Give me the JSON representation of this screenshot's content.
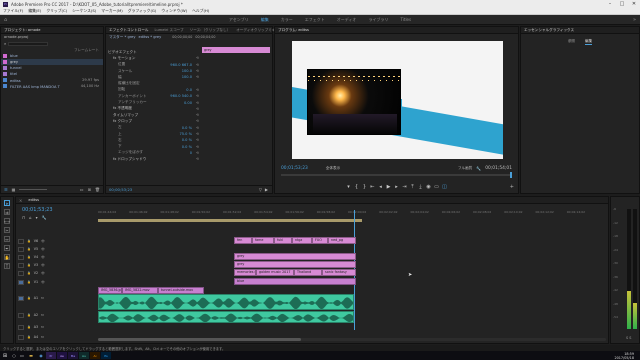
{
  "window": {
    "title": "Adobe Premiere Pro CC 2017 - D:\\KDOT_05_Adobe_tutorial\\tpremiere\\timeline.prproj *"
  },
  "menu": [
    "ファイル(F)",
    "編集(E)",
    "クリップ(C)",
    "シーケンス(S)",
    "マーカー(M)",
    "グラフィック(G)",
    "ウィンドウ(W)",
    "ヘルプ(H)"
  ],
  "workspaces": [
    {
      "label": "アセンブリ",
      "active": false
    },
    {
      "label": "編集",
      "active": true
    },
    {
      "label": "カラー",
      "active": false
    },
    {
      "label": "エフェクト",
      "active": false
    },
    {
      "label": "オーディオ",
      "active": false
    },
    {
      "label": "ライブラリ",
      "active": false
    },
    {
      "label": "Titles",
      "active": false
    }
  ],
  "project": {
    "tab": "プロジェクト: ornode",
    "filename": "ornode.prproj",
    "search_placeholder": "検索",
    "items_label": "フレームレート",
    "items": [
      {
        "label": "blue",
        "color": "#d06ad0",
        "fps": ""
      },
      {
        "label": "grey",
        "color": "#d06ad0",
        "fps": ""
      },
      {
        "label": "tunnel",
        "color": "#a77ad2",
        "fps": ""
      },
      {
        "label": "titel",
        "color": "#a77ad2",
        "fps": ""
      },
      {
        "label": "editss",
        "color": "#4c86cf",
        "fps": "29.97 fps"
      },
      {
        "label": "FILTER AAS kmp MANDOA T",
        "color": "#4c86cf",
        "fps": "44,100 Hz"
      }
    ]
  },
  "effects": {
    "tabs": [
      "エフェクトコントロール",
      "Lumetri スコープ",
      "ソース:（クリップなし）",
      "オーディオクリップミキサー"
    ],
    "source": "マスター * grey",
    "sequence": "editss * grey",
    "tc_start": "00;00;00;00",
    "tc_end": "00;00;04;00",
    "clip_label": "grey",
    "sections": [
      {
        "label": "ビデオエフェクト",
        "indent": 0
      },
      {
        "label": "fx モーション",
        "indent": 1
      },
      {
        "label": "位置",
        "indent": 2,
        "value": "960.0  667.0"
      },
      {
        "label": "スケール",
        "indent": 2,
        "value": "100.0"
      },
      {
        "label": "幅",
        "indent": 2,
        "value": "100.0"
      },
      {
        "label": "縦横比を固定",
        "indent": 2,
        "value": ""
      },
      {
        "label": "回転",
        "indent": 2,
        "value": "0.0"
      },
      {
        "label": "アンカーポイント",
        "indent": 2,
        "value": "960.0  540.0"
      },
      {
        "label": "アンチフリッカー",
        "indent": 2,
        "value": "0.00"
      },
      {
        "label": "fx 不透明度",
        "indent": 1
      },
      {
        "label": "タイムリマップ",
        "indent": 1
      },
      {
        "label": "fx クロップ",
        "indent": 1
      },
      {
        "label": "左",
        "indent": 2,
        "value": "0.0 %"
      },
      {
        "label": "上",
        "indent": 2,
        "value": "75.0 %"
      },
      {
        "label": "右",
        "indent": 2,
        "value": "0.0 %"
      },
      {
        "label": "下",
        "indent": 2,
        "value": "0.0 %"
      },
      {
        "label": "エッジをぼかす",
        "indent": 2,
        "value": "0"
      },
      {
        "label": "fx ドロップシャドウ",
        "indent": 1
      }
    ],
    "bottom_tc": "00;00;53;23"
  },
  "program": {
    "tab": "プログラム: editss",
    "tc_left": "00;01;53;23",
    "fit": "全体表示",
    "quality": "フル画質",
    "tc_right": "00;01;54;01"
  },
  "essential": {
    "title": "エッセンシャルグラフィックス",
    "tabs": [
      "参照",
      "編集"
    ]
  },
  "timeline": {
    "seq_name": "editss",
    "timecode": "00;01;53;23",
    "ruler": [
      "00;01;44;02",
      "00;01;46;02",
      "00;01;48;02",
      "00;01;50;02",
      "00;01;52;02",
      "00;01;54;02",
      "00;01;56;02",
      "00;01;58;02",
      "00;02;00;02",
      "00;02;02;02",
      "00;02;04;02",
      "00;02;06;02",
      "00;02;08;02",
      "00;02;10;02",
      "00;02;12;02",
      "00;02;14;02"
    ],
    "tracks": [
      {
        "label": "V6"
      },
      {
        "label": "V5"
      },
      {
        "label": "V4"
      },
      {
        "label": "V3"
      },
      {
        "label": "V2"
      },
      {
        "label": "V1"
      },
      {
        "label": "A1"
      },
      {
        "label": "A2"
      },
      {
        "label": "A3"
      },
      {
        "label": "A4"
      }
    ],
    "clips_v6": [
      {
        "label": "fen"
      },
      {
        "label": "fame"
      },
      {
        "label": "fukl"
      },
      {
        "label": "ntgz"
      },
      {
        "label": "FUO"
      },
      {
        "label": "ned_pg"
      }
    ],
    "clip_grey1": "grey",
    "clip_grey2": "grey",
    "clips_v3": [
      "memories of",
      "golden music 2017",
      "Thailand",
      "sonic fantasy"
    ],
    "clip_blue": "blue",
    "clips_v1": [
      "IMG_5836.jpg",
      "IMG_5822.mov",
      "tunnel-outside.mov"
    ],
    "audio_label": "A1",
    "meter_values": [
      "-6",
      "-12",
      "-18",
      "-24",
      "-30",
      "-36",
      "-42",
      "-48",
      "-54"
    ],
    "meter_bottom": "S S",
    "meter_levels": [
      0.32,
      0.22
    ]
  },
  "statusbar": "クリックすると選択、または空のエリアをクリックしてドラッグすると範囲選択します。Shift、Alt、Ctrl キーでその他のオプションが使用できます。",
  "taskbar": {
    "time": "18:59",
    "date": "2017/05/18"
  }
}
